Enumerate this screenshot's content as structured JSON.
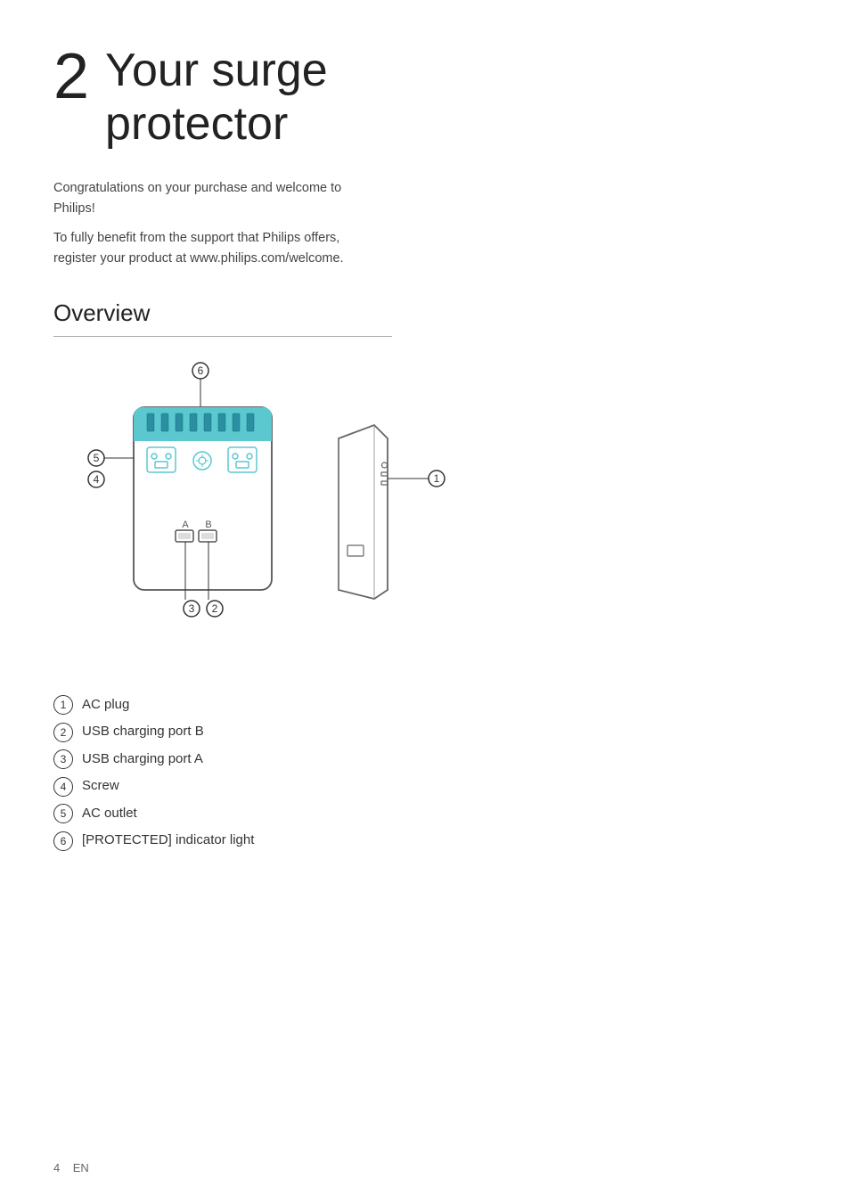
{
  "chapter": {
    "number": "2",
    "title_line1": "Your surge",
    "title_line2": "protector"
  },
  "intro": {
    "para1": "Congratulations on your purchase and welcome to Philips!",
    "para2": "To fully benefit from the support that Philips offers, register your product at www.philips.com/welcome."
  },
  "overview": {
    "title": "Overview"
  },
  "legend": [
    {
      "num": "1",
      "label": "AC plug"
    },
    {
      "num": "2",
      "label": "USB charging port B"
    },
    {
      "num": "3",
      "label": "USB charging port A"
    },
    {
      "num": "4",
      "label": "Screw"
    },
    {
      "num": "5",
      "label": "AC outlet"
    },
    {
      "num": "6",
      "label": "[PROTECTED] indicator light"
    }
  ],
  "footer": {
    "page": "4",
    "lang": "EN"
  }
}
